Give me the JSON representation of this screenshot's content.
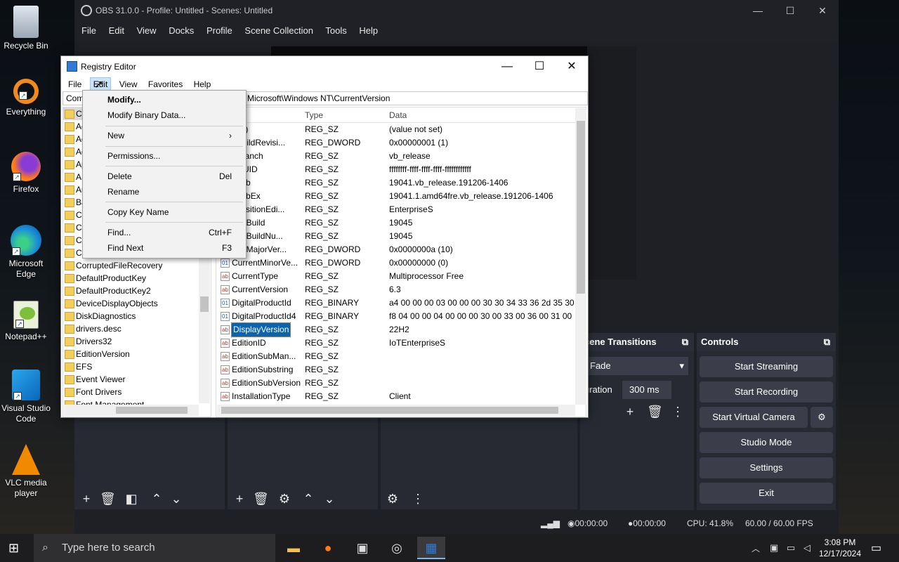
{
  "desktop": {
    "icons": [
      {
        "label": "Recycle Bin",
        "name": "recycle-bin-icon"
      },
      {
        "label": "Everything",
        "name": "everything-icon"
      },
      {
        "label": "Firefox",
        "name": "firefox-icon"
      },
      {
        "label": "Microsoft Edge",
        "name": "edge-icon"
      },
      {
        "label": "Notepad++",
        "name": "notepadpp-icon"
      },
      {
        "label": "Visual Studio Code",
        "name": "vscode-icon"
      },
      {
        "label": "VLC media player",
        "name": "vlc-icon"
      }
    ],
    "partial_label": "M"
  },
  "obs": {
    "title": "OBS 31.0.0 - Profile: Untitled - Scenes: Untitled",
    "menu": [
      "File",
      "Edit",
      "View",
      "Docks",
      "Profile",
      "Scene Collection",
      "Tools",
      "Help"
    ],
    "transitions": {
      "header": "cene Transitions",
      "value": "Fade",
      "duration_label": "uration",
      "duration": "300 ms"
    },
    "controls": {
      "header": "Controls",
      "buttons": [
        "Start Streaming",
        "Start Recording",
        "Start Virtual Camera",
        "Studio Mode",
        "Settings",
        "Exit"
      ]
    },
    "status": {
      "stream_time": "00:00:00",
      "rec_time": "00:00:00",
      "cpu": "CPU: 41.8%",
      "fps": "60.00 / 60.00 FPS"
    }
  },
  "registry": {
    "title": "Registry Editor",
    "menu": [
      "File",
      "Edit",
      "View",
      "Favorites",
      "Help"
    ],
    "address_left": "Com",
    "address_right": "Microsoft\\Windows NT\\CurrentVersion",
    "tree": [
      "Curre",
      "Ac",
      "Ac",
      "Ae",
      "Ap",
      "AS",
      "Au",
      "Ba",
      "Cl",
      "Co",
      "Co",
      "Co",
      "CorruptedFileRecovery",
      "DefaultProductKey",
      "DefaultProductKey2",
      "DeviceDisplayObjects",
      "DiskDiagnostics",
      "drivers.desc",
      "Drivers32",
      "EditionVersion",
      "EFS",
      "Event Viewer",
      "Font Drivers",
      "Font Management"
    ],
    "columns": {
      "type": "Type",
      "data": "Data"
    },
    "rows": [
      {
        "name": "ault)",
        "type": "REG_SZ",
        "data": "(value not set)",
        "icon": "ab"
      },
      {
        "name": "eBuildRevisi...",
        "type": "REG_DWORD",
        "data": "0x00000001 (1)",
        "icon": "bin"
      },
      {
        "name": "dBranch",
        "type": "REG_SZ",
        "data": "vb_release",
        "icon": "ab"
      },
      {
        "name": "dGUID",
        "type": "REG_SZ",
        "data": "ffffffff-ffff-ffff-ffff-ffffffffffff",
        "icon": "ab"
      },
      {
        "name": "dLab",
        "type": "REG_SZ",
        "data": "19041.vb_release.191206-1406",
        "icon": "ab"
      },
      {
        "name": "dLabEx",
        "type": "REG_SZ",
        "data": "19041.1.amd64fre.vb_release.191206-1406",
        "icon": "ab"
      },
      {
        "name": "npositionEdi...",
        "type": "REG_SZ",
        "data": "EnterpriseS",
        "icon": "ab"
      },
      {
        "name": "rentBuild",
        "type": "REG_SZ",
        "data": "19045",
        "icon": "ab"
      },
      {
        "name": "rentBuildNu...",
        "type": "REG_SZ",
        "data": "19045",
        "icon": "ab"
      },
      {
        "name": "rentMajorVer...",
        "type": "REG_DWORD",
        "data": "0x0000000a (10)",
        "icon": "bin"
      },
      {
        "name": "CurrentMinorVe...",
        "type": "REG_DWORD",
        "data": "0x00000000 (0)",
        "icon": "bin"
      },
      {
        "name": "CurrentType",
        "type": "REG_SZ",
        "data": "Multiprocessor Free",
        "icon": "ab"
      },
      {
        "name": "CurrentVersion",
        "type": "REG_SZ",
        "data": "6.3",
        "icon": "ab"
      },
      {
        "name": "DigitalProductId",
        "type": "REG_BINARY",
        "data": "a4 00 00 00 03 00 00 00 30 30 34 33 36 2d 35 30 30 3...",
        "icon": "bin"
      },
      {
        "name": "DigitalProductId4",
        "type": "REG_BINARY",
        "data": "f8 04 00 00 04 00 00 00 30 00 33 00 36 00 31 00 32 00",
        "icon": "bin"
      },
      {
        "name": "DisplayVersion",
        "type": "REG_SZ",
        "data": "22H2",
        "icon": "ab",
        "selected": true
      },
      {
        "name": "EditionID",
        "type": "REG_SZ",
        "data": "IoTEnterpriseS",
        "icon": "ab"
      },
      {
        "name": "EditionSubMan...",
        "type": "REG_SZ",
        "data": "",
        "icon": "ab"
      },
      {
        "name": "EditionSubstring",
        "type": "REG_SZ",
        "data": "",
        "icon": "ab"
      },
      {
        "name": "EditionSubVersion",
        "type": "REG_SZ",
        "data": "",
        "icon": "ab"
      },
      {
        "name": "InstallationType",
        "type": "REG_SZ",
        "data": "Client",
        "icon": "ab"
      }
    ],
    "edit_menu": [
      {
        "label": "Modify...",
        "bold": true
      },
      {
        "label": "Modify Binary Data..."
      },
      {
        "label": "New",
        "submenu": "›"
      },
      {
        "label": "Permissions..."
      },
      {
        "label": "Delete",
        "accel": "Del"
      },
      {
        "label": "Rename"
      },
      {
        "label": "Copy Key Name"
      },
      {
        "label": "Find...",
        "accel": "Ctrl+F"
      },
      {
        "label": "Find Next",
        "accel": "F3"
      }
    ]
  },
  "taskbar": {
    "search_placeholder": "Type here to search",
    "time": "3:08 PM",
    "date": "12/17/2024"
  }
}
